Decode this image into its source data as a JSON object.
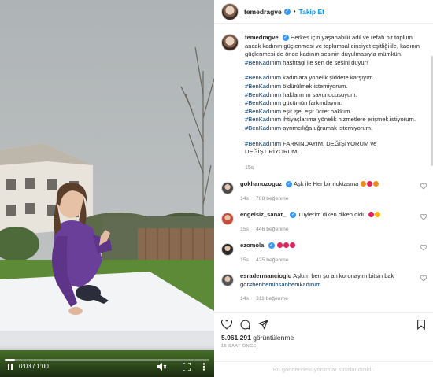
{
  "video": {
    "current_time": "0:03",
    "duration": "1:00",
    "time_separator": " / ",
    "progress_fraction": 0.05,
    "icons": [
      "pause-icon",
      "volume-muted-icon",
      "fullscreen-icon",
      "more-options-icon"
    ]
  },
  "header": {
    "username": "temedragve",
    "verified": true,
    "follow_label": "Takip Et"
  },
  "post": {
    "username": "temedragve",
    "lines": [
      "Herkes için yaşanabilir adil ve refah bir toplum",
      "ancak kadının güçlenmesi ve toplumsal cinsiyet eşitliği ile, kadının",
      "güçlenmesi de önce kadının sesinin duyulmasıyla mümkün.",
      "hashtagi ile sen de sesini duyur!"
    ],
    "hashtag": "#BenKadınım",
    "items": [
      "kadınlara yönelik şiddete karşıyım.",
      "öldürülmek istemiyorum.",
      "haklarımın savunucusuyum.",
      "gücümün farkındayım.",
      "eşit işe, eşit ücret hakkım.",
      "ihtiyaçlarıma yönelik hizmetlere erişmek istiyorum.",
      "ayrımcılığa uğramak istemiyorum."
    ],
    "closing": "FARKINDAYIM, DEĞİŞİYORUM ve DEĞİŞTİRİYORUM.",
    "age": "15s"
  },
  "comments": [
    {
      "username": "gokhanozoguz",
      "verified": true,
      "text": "Aşk ile Her bir noktasına",
      "emojis": [
        "#f08c1a",
        "#e0245e",
        "#f08c1a"
      ],
      "age": "14s",
      "likes": "788 beğenme",
      "avatar": "#4a4a4a"
    },
    {
      "username": "engelsiz_sanat_",
      "verified": true,
      "text": "Tüylerim diken diken oldu",
      "emojis": [
        "#e0245e",
        "#f5b400"
      ],
      "age": "15s",
      "likes": "446 beğenme",
      "avatar": "#c94b3a"
    },
    {
      "username": "ezomola",
      "verified": true,
      "text": "",
      "emojis": [
        "#e0245e",
        "#e0245e",
        "#e0245e"
      ],
      "age": "15s",
      "likes": "425 beğenme",
      "avatar": "#2b2b2b"
    },
    {
      "username": "esradermancioglu",
      "verified": false,
      "text": "Aşkım ben şu an koronayım bitsin bak gör",
      "tag": "#benheminsanhemkadınım",
      "emojis": [],
      "age": "14s",
      "likes": "311 beğenme",
      "avatar": "#555555"
    }
  ],
  "actions": {
    "views_count": "5.961.291",
    "views_label": "görüntülenme",
    "time_ago": "15 SAAT ÖNCE",
    "comments_limited": "Bu gönderideki yorumlar sınırlandırıldı."
  },
  "colors": {
    "link": "#0095f6",
    "hashtag": "#00376b",
    "muted": "#8e8e8e",
    "like": "#e0245e"
  }
}
